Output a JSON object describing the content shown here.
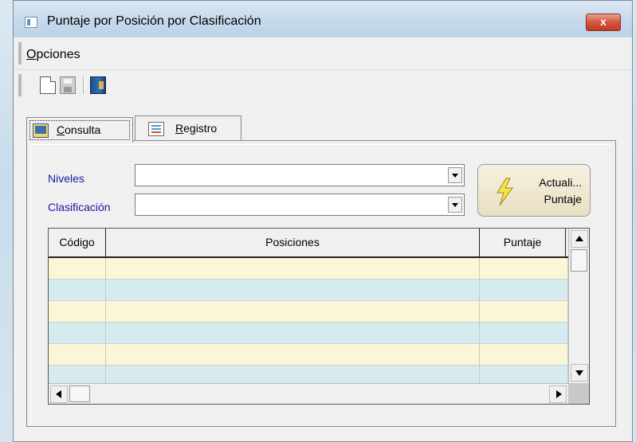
{
  "window": {
    "title": "Puntaje por Posición por Clasificación",
    "close_label": "x"
  },
  "menu": {
    "items": [
      {
        "label_prefix": "",
        "underline": "O",
        "label_rest": "pciones"
      }
    ]
  },
  "toolbar": {
    "buttons": [
      "new-icon",
      "save-icon",
      "exit-icon"
    ]
  },
  "tabs": [
    {
      "underline": "C",
      "rest": "onsulta",
      "selected": true
    },
    {
      "underline": "R",
      "rest": "egistro",
      "selected": false
    }
  ],
  "form": {
    "niveles_label": "Niveles",
    "niveles_value": "",
    "clasificacion_label": "Clasificación",
    "clasificacion_value": ""
  },
  "action_button": {
    "line1": "Actuali...",
    "line2": "Puntaje"
  },
  "grid": {
    "columns": [
      "Código",
      "Posiciones",
      "Puntaje"
    ],
    "rows": [
      [
        "",
        "",
        ""
      ],
      [
        "",
        "",
        ""
      ],
      [
        "",
        "",
        ""
      ],
      [
        "",
        "",
        ""
      ],
      [
        "",
        "",
        ""
      ],
      [
        "",
        "",
        ""
      ]
    ]
  },
  "colors": {
    "label_blue": "#1a1aa8",
    "row_odd": "#fbf6d5",
    "row_even": "#d5ebf0"
  }
}
